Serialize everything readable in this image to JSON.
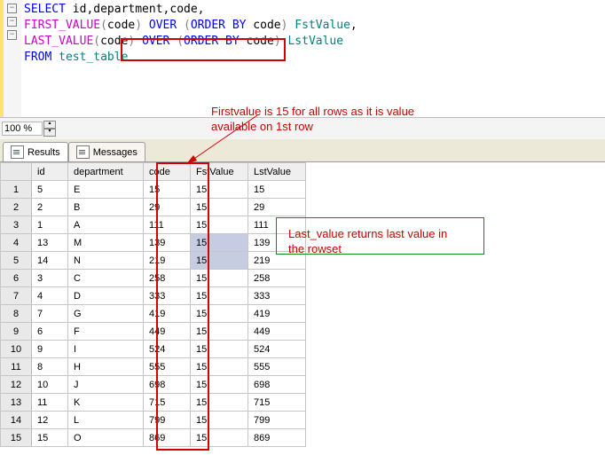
{
  "sql": {
    "line1_pre": "SELECT",
    "line1_cols": " id,department,code,",
    "line2_func": "FIRST_VALUE",
    "line2_arg": "code",
    "line2_over": "OVER",
    "line2_orderby": "ORDER BY",
    "line2_ordcol": " code",
    "line2_alias": " FstValue",
    "line3_func": "LAST_VALUE",
    "line3_arg": "code",
    "line3_over": "OVER",
    "line3_orderby": "ORDER BY",
    "line3_ordcol": " code",
    "line3_alias": " LstValue",
    "line4_from": "FROM",
    "line4_table": " test_table"
  },
  "zoom": {
    "value": "100 %"
  },
  "tabs": {
    "results": "Results",
    "messages": "Messages"
  },
  "grid": {
    "headers": {
      "blank": "",
      "id": "id",
      "department": "department",
      "code": "code",
      "fst": "FstValue",
      "lst": "LstValue"
    },
    "rows": [
      {
        "n": "1",
        "id": "5",
        "dep": "E",
        "code": "15",
        "fst": "15",
        "lst": "15"
      },
      {
        "n": "2",
        "id": "2",
        "dep": "B",
        "code": "29",
        "fst": "15",
        "lst": "29"
      },
      {
        "n": "3",
        "id": "1",
        "dep": "A",
        "code": "111",
        "fst": "15",
        "lst": "111"
      },
      {
        "n": "4",
        "id": "13",
        "dep": "M",
        "code": "139",
        "fst": "15",
        "lst": "139"
      },
      {
        "n": "5",
        "id": "14",
        "dep": "N",
        "code": "219",
        "fst": "15",
        "lst": "219"
      },
      {
        "n": "6",
        "id": "3",
        "dep": "C",
        "code": "258",
        "fst": "15",
        "lst": "258"
      },
      {
        "n": "7",
        "id": "4",
        "dep": "D",
        "code": "333",
        "fst": "15",
        "lst": "333"
      },
      {
        "n": "8",
        "id": "7",
        "dep": "G",
        "code": "419",
        "fst": "15",
        "lst": "419"
      },
      {
        "n": "9",
        "id": "6",
        "dep": "F",
        "code": "449",
        "fst": "15",
        "lst": "449"
      },
      {
        "n": "10",
        "id": "9",
        "dep": "I",
        "code": "524",
        "fst": "15",
        "lst": "524"
      },
      {
        "n": "11",
        "id": "8",
        "dep": "H",
        "code": "555",
        "fst": "15",
        "lst": "555"
      },
      {
        "n": "12",
        "id": "10",
        "dep": "J",
        "code": "698",
        "fst": "15",
        "lst": "698"
      },
      {
        "n": "13",
        "id": "11",
        "dep": "K",
        "code": "715",
        "fst": "15",
        "lst": "715"
      },
      {
        "n": "14",
        "id": "12",
        "dep": "L",
        "code": "799",
        "fst": "15",
        "lst": "799"
      },
      {
        "n": "15",
        "id": "15",
        "dep": "O",
        "code": "869",
        "fst": "15",
        "lst": "869"
      }
    ]
  },
  "annotations": {
    "first": "Firstvalue is 15 for all rows as it is value available on 1st row",
    "last": "Last_value returns last value in the rowset"
  },
  "chart_data": {
    "type": "table",
    "title": "FIRST_VALUE / LAST_VALUE over code",
    "columns": [
      "id",
      "department",
      "code",
      "FstValue",
      "LstValue"
    ],
    "rows": [
      [
        5,
        "E",
        15,
        15,
        15
      ],
      [
        2,
        "B",
        29,
        15,
        29
      ],
      [
        1,
        "A",
        111,
        15,
        111
      ],
      [
        13,
        "M",
        139,
        15,
        139
      ],
      [
        14,
        "N",
        219,
        15,
        219
      ],
      [
        3,
        "C",
        258,
        15,
        258
      ],
      [
        4,
        "D",
        333,
        15,
        333
      ],
      [
        7,
        "G",
        419,
        15,
        419
      ],
      [
        6,
        "F",
        449,
        15,
        449
      ],
      [
        9,
        "I",
        524,
        15,
        524
      ],
      [
        8,
        "H",
        555,
        15,
        555
      ],
      [
        10,
        "J",
        698,
        15,
        698
      ],
      [
        11,
        "K",
        715,
        15,
        715
      ],
      [
        12,
        "L",
        799,
        15,
        799
      ],
      [
        15,
        "O",
        869,
        15,
        869
      ]
    ]
  }
}
